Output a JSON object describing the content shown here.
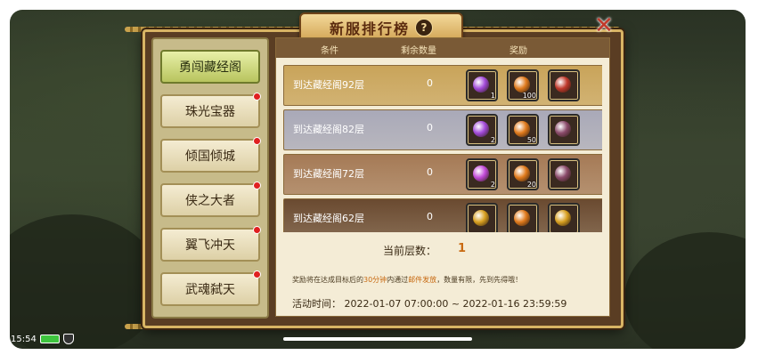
{
  "window": {
    "title": "新服排行榜"
  },
  "icons": {
    "help": "question-icon",
    "close": "close-x-icon"
  },
  "sidebar": {
    "items": [
      {
        "label": "勇闯藏经阁",
        "active": true,
        "badge": false
      },
      {
        "label": "珠光宝器",
        "active": false,
        "badge": true
      },
      {
        "label": "倾国倾城",
        "active": false,
        "badge": true
      },
      {
        "label": "侠之大者",
        "active": false,
        "badge": true
      },
      {
        "label": "翼飞冲天",
        "active": false,
        "badge": true
      },
      {
        "label": "武魂弑天",
        "active": false,
        "badge": true
      }
    ]
  },
  "table": {
    "headers": {
      "condition": "条件",
      "remaining": "剩余数量",
      "reward": "奖励"
    },
    "rows": [
      {
        "condition": "到达藏经阁92层",
        "remaining": "0",
        "theme": "#c9a45a",
        "rewards": [
          {
            "icon": "purple-gem-icon",
            "count": "1",
            "color": "#a24ad8"
          },
          {
            "icon": "orange-orb-icon",
            "count": "100",
            "color": "#e07a1c"
          },
          {
            "icon": "red-card-icon",
            "count": "",
            "color": "#c0392b"
          }
        ]
      },
      {
        "condition": "到达藏经阁82层",
        "remaining": "0",
        "theme": "#a9a9b8",
        "rewards": [
          {
            "icon": "purple-gem-icon",
            "count": "2",
            "color": "#a24ad8"
          },
          {
            "icon": "orange-orb-icon",
            "count": "50",
            "color": "#e07a1c"
          },
          {
            "icon": "hero-portrait-icon",
            "count": "",
            "color": "#8a4a6a"
          }
        ]
      },
      {
        "condition": "到达藏经阁72层",
        "remaining": "0",
        "theme": "#a57a56",
        "rewards": [
          {
            "icon": "purple-gem-icon",
            "count": "2",
            "color": "#c24ad8"
          },
          {
            "icon": "orange-orb-icon",
            "count": "20",
            "color": "#e07a1c"
          },
          {
            "icon": "hero-portrait-icon",
            "count": "",
            "color": "#8a4a6a"
          }
        ]
      },
      {
        "condition": "到达藏经阁62层",
        "remaining": "0",
        "theme": "#6a4a30",
        "rewards": [
          {
            "icon": "gold-ingot-icon",
            "count": "",
            "color": "#d8a020"
          },
          {
            "icon": "orange-orb-icon",
            "count": "",
            "color": "#e07a1c"
          },
          {
            "icon": "gold-gourd-icon",
            "count": "",
            "color": "#d8a020"
          }
        ]
      }
    ]
  },
  "current_floor": {
    "label": "当前层数：",
    "value": "1"
  },
  "notice": {
    "before": "奖励将在达成目标后的",
    "time": "30分钟",
    "middle": "内通过",
    "mail": "邮件发放",
    "after": "，数量有限，先到先得哦！"
  },
  "activity": {
    "label": "活动时间：",
    "range": "2022-01-07 07:00:00 ~ 2022-01-16 23:59:59"
  },
  "status_bar": {
    "time": "15:54"
  }
}
